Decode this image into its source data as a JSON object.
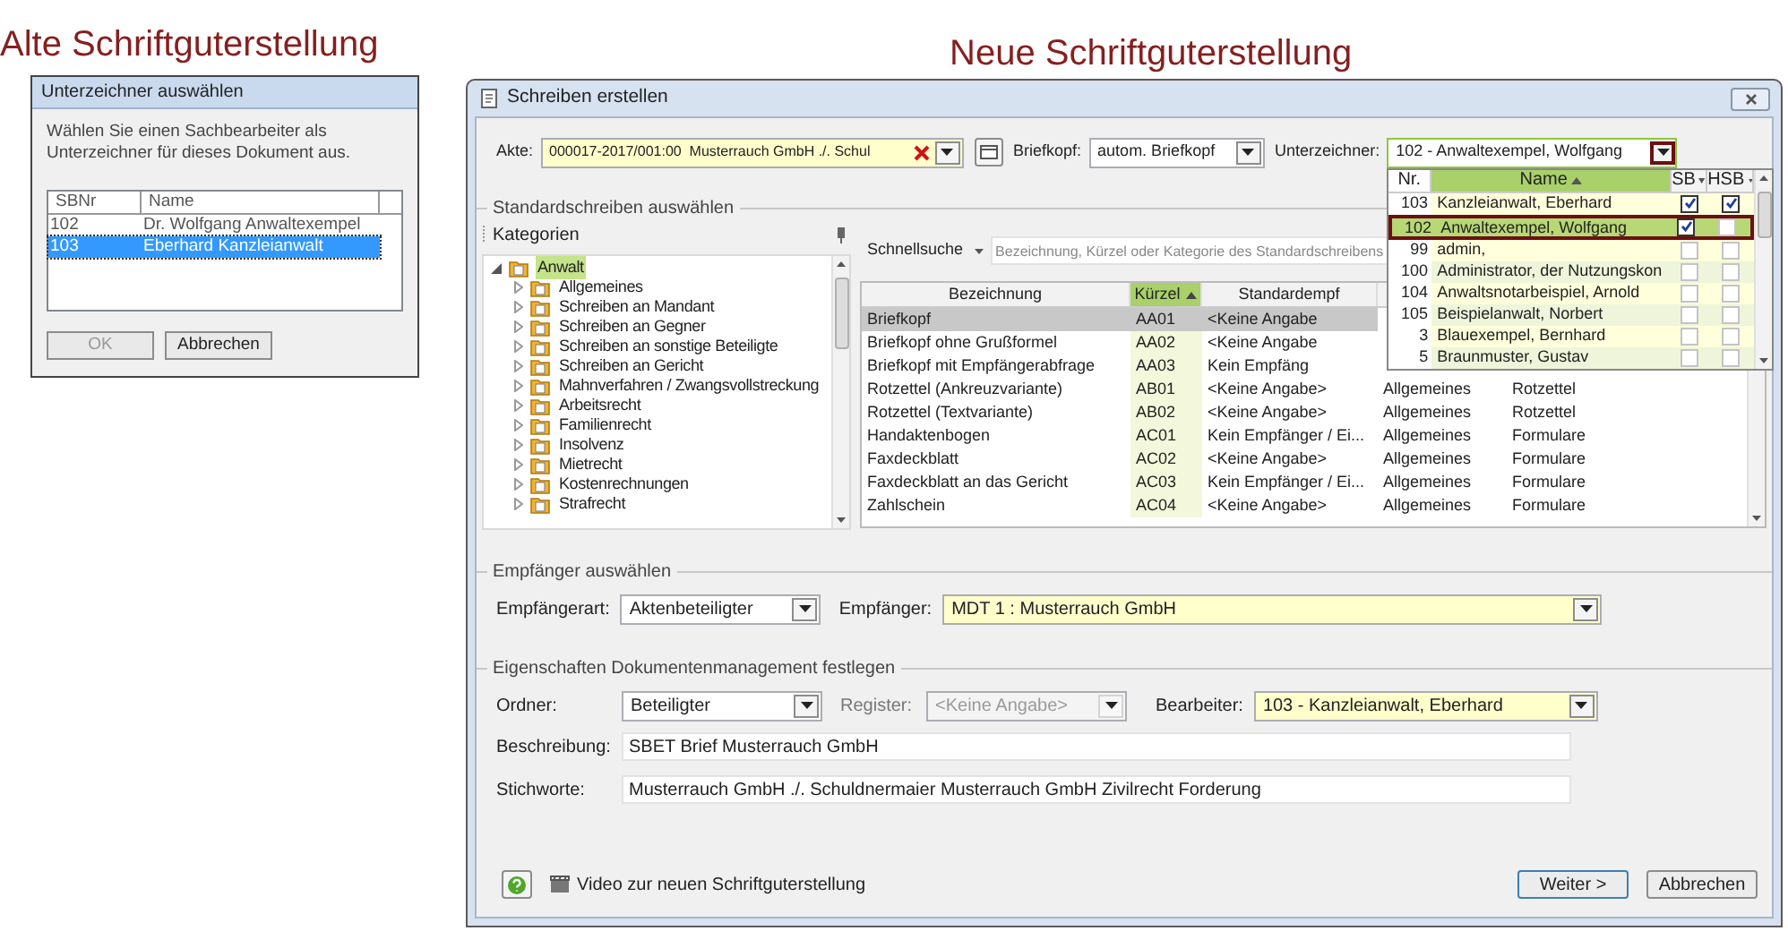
{
  "old_version": {
    "heading": "Alte Schriftguterstellung",
    "dialog": {
      "title": "Unterzeichner auswählen",
      "message": "Wählen Sie einen Sachbearbeiter als Unterzeichner für dieses Dokument aus.",
      "columns": [
        "SBNr",
        "Name"
      ],
      "rows": [
        {
          "cells": [
            "102",
            "Dr. Wolfgang Anwaltexempel"
          ],
          "selected": false
        },
        {
          "cells": [
            "103",
            "Eberhard Kanzleianwalt"
          ],
          "selected": true
        }
      ],
      "buttons": [
        {
          "label": "OK",
          "disabled": true
        },
        {
          "label": "Abbrechen",
          "disabled": false
        }
      ]
    }
  },
  "new_version": {
    "heading": "Neue Schriftguterstellung",
    "window": {
      "title": "Schreiben erstellen"
    },
    "akte": {
      "label": "Akte:",
      "value": "000017-2017/001:00  Musterrauch GmbH ./. Schul",
      "required": true
    },
    "briefkopf": {
      "label": "Briefkopf:",
      "value": "autom. Briefkopf",
      "required": false
    },
    "unterzeichner": {
      "label": "Unterzeichner:",
      "value": "102 - Anwaltexempel, Wolfgang",
      "expanded": true,
      "columns": [
        "Nr.",
        "Name",
        "SB",
        "HSB"
      ],
      "rows": [
        {
          "nr": "103",
          "name": "Kanzleianwalt, Eberhard",
          "sb": true,
          "hsb": true,
          "selected": false
        },
        {
          "nr": "102",
          "name": "Anwaltexempel, Wolfgang",
          "sb": true,
          "hsb": false,
          "selected": true
        },
        {
          "nr": "99",
          "name": "admin,",
          "sb": false,
          "hsb": false,
          "selected": false
        },
        {
          "nr": "100",
          "name": "Administrator, der Nutzungskon",
          "sb": false,
          "hsb": false,
          "selected": false
        },
        {
          "nr": "104",
          "name": "Anwaltsnotarbeispiel, Arnold",
          "sb": false,
          "hsb": false,
          "selected": false
        },
        {
          "nr": "105",
          "name": "Beispielanwalt, Norbert",
          "sb": false,
          "hsb": false,
          "selected": false
        },
        {
          "nr": "3",
          "name": "Blauexempel, Bernhard",
          "sb": false,
          "hsb": false,
          "selected": false
        },
        {
          "nr": "5",
          "name": "Braunmuster, Gustav",
          "sb": false,
          "hsb": false,
          "selected": false
        }
      ]
    },
    "standard": {
      "title": "Standardschreiben auswählen",
      "tree": {
        "header": "Kategorien",
        "items": [
          {
            "label": "Anwalt",
            "selected": true,
            "expanded": true,
            "children": [
              {
                "label": "Allgemeines",
                "selected": false,
                "expanded": false
              },
              {
                "label": "Schreiben an Mandant",
                "selected": false,
                "expanded": false
              },
              {
                "label": "Schreiben an Gegner",
                "selected": false,
                "expanded": false
              },
              {
                "label": "Schreiben an sonstige Beteiligte",
                "selected": false,
                "expanded": false
              },
              {
                "label": "Schreiben an Gericht",
                "selected": false,
                "expanded": false
              },
              {
                "label": "Mahnverfahren / Zwangsvollstreckung",
                "selected": false,
                "expanded": false
              },
              {
                "label": "Arbeitsrecht",
                "selected": false,
                "expanded": false
              },
              {
                "label": "Familienrecht",
                "selected": false,
                "expanded": false
              },
              {
                "label": "Insolvenz",
                "selected": false,
                "expanded": false
              },
              {
                "label": "Mietrecht",
                "selected": false,
                "expanded": false
              },
              {
                "label": "Kostenrechnungen",
                "selected": false,
                "expanded": false
              },
              {
                "label": "Strafrecht",
                "selected": false,
                "expanded": false
              }
            ]
          }
        ]
      },
      "quick_search": {
        "label": "Schnellsuche",
        "placeholder": "Bezeichnung, Kürzel oder Kategorie des Standardschreibens"
      },
      "table": {
        "columns": [
          {
            "label": "Bezeichnung",
            "sorted": false
          },
          {
            "label": "Kürzel",
            "sorted": true
          },
          {
            "label": "Standardempf",
            "sorted": false
          }
        ],
        "rows": [
          {
            "cells": [
              "Briefkopf",
              "AA01",
              "<Keine Angabe"
            ],
            "selected": true
          },
          {
            "cells": [
              "Briefkopf ohne Grußformel",
              "AA02",
              "<Keine Angabe"
            ],
            "selected": false
          },
          {
            "cells": [
              "Briefkopf mit Empfängerabfrage",
              "AA03",
              "Kein Empfäng"
            ],
            "selected": false
          },
          {
            "cells": [
              "Rotzettel (Ankreuzvariante)",
              "AB01",
              "<Keine Angabe>",
              "Allgemeines",
              "Rotzettel"
            ],
            "selected": false
          },
          {
            "cells": [
              "Rotzettel (Textvariante)",
              "AB02",
              "<Keine Angabe>",
              "Allgemeines",
              "Rotzettel"
            ],
            "selected": false
          },
          {
            "cells": [
              "Handaktenbogen",
              "AC01",
              "Kein Empfänger / Ei...",
              "Allgemeines",
              "Formulare"
            ],
            "selected": false
          },
          {
            "cells": [
              "Faxdeckblatt",
              "AC02",
              "<Keine Angabe>",
              "Allgemeines",
              "Formulare"
            ],
            "selected": false
          },
          {
            "cells": [
              "Faxdeckblatt an das Gericht",
              "AC03",
              "Kein Empfänger / Ei...",
              "Allgemeines",
              "Formulare"
            ],
            "selected": false
          },
          {
            "cells": [
              "Zahlschein",
              "AC04",
              "<Keine Angabe>",
              "Allgemeines",
              "Formulare"
            ],
            "selected": false
          }
        ]
      }
    },
    "recipient": {
      "title": "Empfänger auswählen",
      "fields": [
        {
          "label": "Empfängerart:",
          "value": "Aktenbeteiligter",
          "required": false,
          "disabled": false
        },
        {
          "label": "Empfänger:",
          "value": "MDT 1 : Musterrauch GmbH",
          "required": true,
          "disabled": false
        }
      ]
    },
    "document_management": {
      "title": "Eigenschaften Dokumentenmanagement festlegen",
      "combos": [
        {
          "label": "Ordner:",
          "value": "Beteiligter",
          "required": false,
          "disabled": false
        },
        {
          "label": "Register:",
          "value": "<Keine Angabe>",
          "disabled": true
        },
        {
          "label": "Bearbeiter:",
          "value": "103 - Kanzleianwalt, Eberhard",
          "required": true,
          "disabled": false
        }
      ],
      "text_fields": [
        {
          "label": "Beschreibung:",
          "value": "SBET Brief Musterrauch GmbH"
        },
        {
          "label": "Stichworte:",
          "value": "Musterrauch GmbH ./. Schuldnermaier Musterrauch GmbH Zivilrecht Forderung"
        }
      ]
    },
    "footer": {
      "video_link": "Video zur neuen Schriftguterstellung",
      "buttons": [
        {
          "label": "Weiter >",
          "default": true
        },
        {
          "label": "Abbrechen",
          "default": false
        }
      ]
    }
  }
}
